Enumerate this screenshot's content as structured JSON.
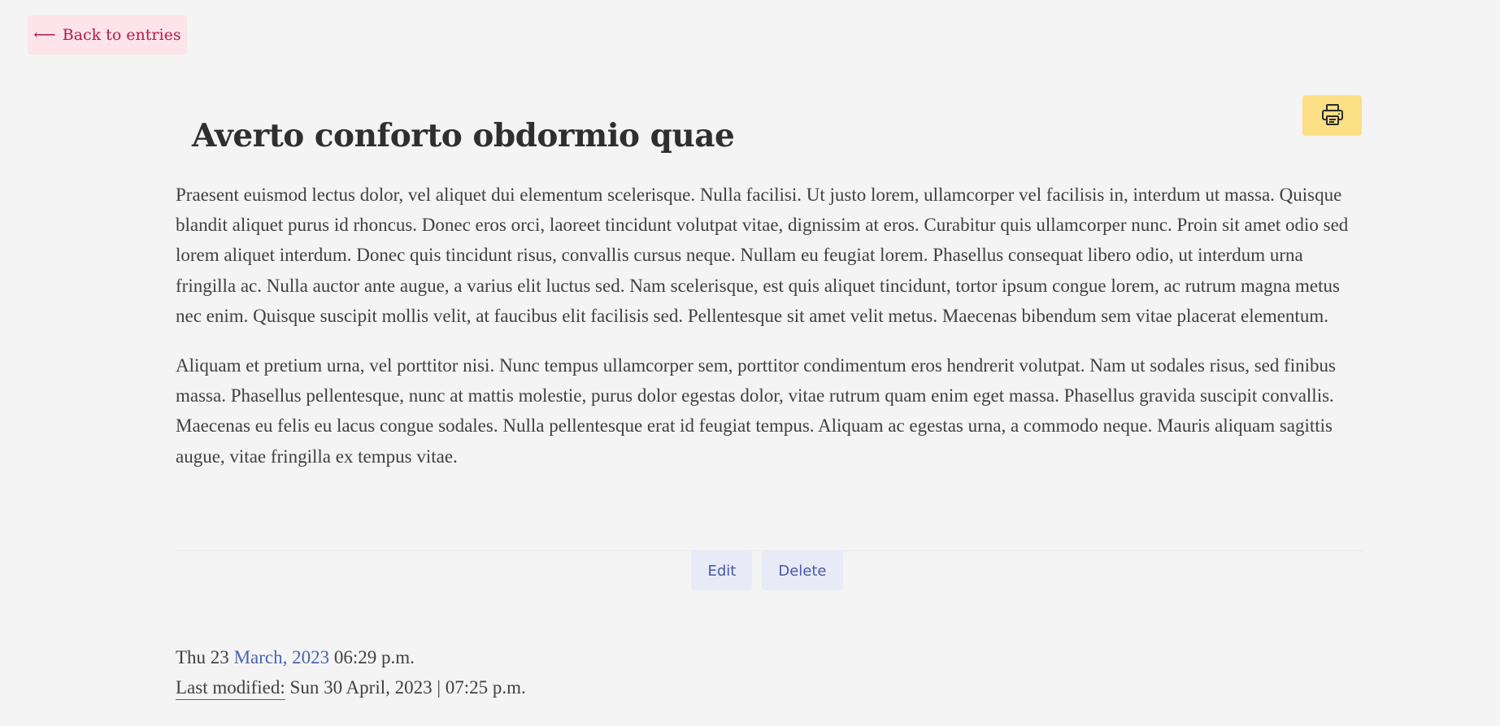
{
  "nav": {
    "back_arrow": "⟵",
    "back_label": "Back to entries"
  },
  "toolbar": {
    "print_icon": "printer-icon"
  },
  "entry": {
    "title": "Averto conforto obdormio quae",
    "paragraphs": [
      "Praesent euismod lectus dolor, vel aliquet dui elementum scelerisque. Nulla facilisi. Ut justo lorem, ullamcorper vel facilisis in, interdum ut massa. Quisque blandit aliquet purus id rhoncus. Donec eros orci, laoreet tincidunt volutpat vitae, dignissim at eros. Curabitur quis ullamcorper nunc. Proin sit amet odio sed lorem aliquet interdum. Donec quis tincidunt risus, convallis cursus neque. Nullam eu feugiat lorem. Phasellus consequat libero odio, ut interdum urna fringilla ac. Nulla auctor ante augue, a varius elit luctus sed. Nam scelerisque, est quis aliquet tincidunt, tortor ipsum congue lorem, ac rutrum magna metus nec enim. Quisque suscipit mollis velit, at faucibus elit facilisis sed. Pellentesque sit amet velit metus. Maecenas bibendum sem vitae placerat elementum.",
      "Aliquam et pretium urna, vel porttitor nisi. Nunc tempus ullamcorper sem, porttitor condimentum eros hendrerit volutpat. Nam ut sodales risus, sed finibus massa. Phasellus pellentesque, nunc at mattis molestie, purus dolor egestas dolor, vitae rutrum quam enim eget massa. Phasellus gravida suscipit convallis. Maecenas eu felis eu lacus congue sodales. Nulla pellentesque erat id feugiat tempus. Aliquam ac egestas urna, a commodo neque. Mauris aliquam sagittis augue, vitae fringilla ex tempus vitae."
    ]
  },
  "actions": {
    "edit_label": "Edit",
    "delete_label": "Delete"
  },
  "meta": {
    "date_prefix": "Thu 23",
    "date_month_link": "March, 2023",
    "date_time": "06:29 p.m.",
    "modified_label": "Last modified:",
    "modified_value": "Sun 30 April, 2023 | 07:25 p.m."
  },
  "colors": {
    "background": "#f4f4f4",
    "back_link_bg": "#fde3ea",
    "back_link_text": "#b0184a",
    "print_button_bg": "#fddf85",
    "action_button_bg": "#e8ebf7",
    "action_button_text": "#4a56a6",
    "month_link": "#4a64b0",
    "modified_underline": "#d4245c"
  }
}
